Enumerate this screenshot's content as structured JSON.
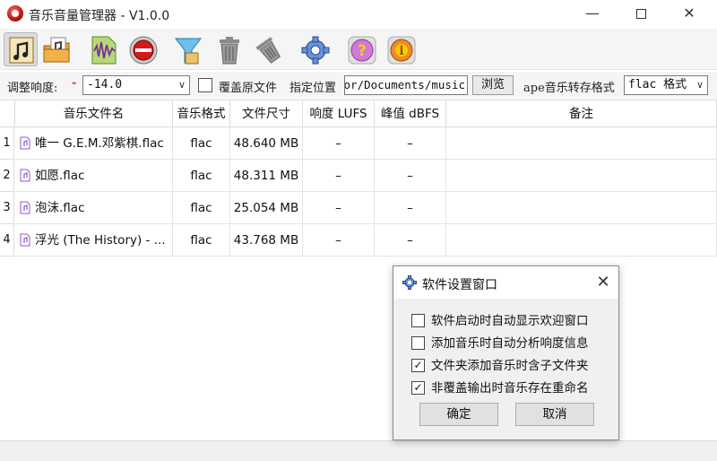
{
  "window": {
    "title": "音乐音量管理器 - V1.0.0",
    "controls": {
      "minimize": "—",
      "close": "✕"
    }
  },
  "toolbar": {
    "items": [
      {
        "name": "add-music-icon",
        "active": true
      },
      {
        "name": "add-folder-icon",
        "active": false
      },
      {
        "name": "analyze-waveform-icon",
        "active": false
      },
      {
        "name": "record-button-icon",
        "active": false
      },
      {
        "name": "filter-funnel-icon",
        "active": false
      },
      {
        "name": "trash-icon",
        "active": false
      },
      {
        "name": "clear-all-icon",
        "active": false
      },
      {
        "name": "gear-icon",
        "active": false
      },
      {
        "name": "help-icon",
        "active": false
      },
      {
        "name": "info-icon",
        "active": false
      }
    ]
  },
  "options": {
    "loudness_label": "调整响度:",
    "loudness_value": "-14.0",
    "overwrite_label": "覆盖原文件",
    "overwrite_checked": false,
    "location_label": "指定位置",
    "location_value": "C:/Users/Administrator/Documents/music",
    "browse_label": "浏览",
    "ape_label": "ape音乐转存格式",
    "ape_format": "flac 格式"
  },
  "table": {
    "columns": [
      "音乐文件名",
      "音乐格式",
      "文件尺寸",
      "响度 LUFS",
      "峰值 dBFS",
      "备注"
    ],
    "rows": [
      {
        "num": "1",
        "name": "唯一 G.E.M.邓紫棋.flac",
        "format": "flac",
        "size": "48.640 MB",
        "lufs": "–",
        "peak": "–",
        "note": ""
      },
      {
        "num": "2",
        "name": "如愿.flac",
        "format": "flac",
        "size": "48.311 MB",
        "lufs": "–",
        "peak": "–",
        "note": ""
      },
      {
        "num": "3",
        "name": "泡沫.flac",
        "format": "flac",
        "size": "25.054 MB",
        "lufs": "–",
        "peak": "–",
        "note": ""
      },
      {
        "num": "4",
        "name": "浮光 (The History) - ...",
        "format": "flac",
        "size": "43.768 MB",
        "lufs": "–",
        "peak": "–",
        "note": ""
      }
    ]
  },
  "dialog": {
    "title": "软件设置窗口",
    "close": "✕",
    "options": [
      {
        "label": "软件启动时自动显示欢迎窗口",
        "checked": false
      },
      {
        "label": "添加音乐时自动分析响度信息",
        "checked": false
      },
      {
        "label": "文件夹添加音乐时含子文件夹",
        "checked": true
      },
      {
        "label": "非覆盖输出时音乐存在重命名",
        "checked": true
      }
    ],
    "ok_label": "确定",
    "cancel_label": "取消"
  },
  "colors": {
    "accent_red": "#d21a1a",
    "file_icon": "#a050c8"
  }
}
